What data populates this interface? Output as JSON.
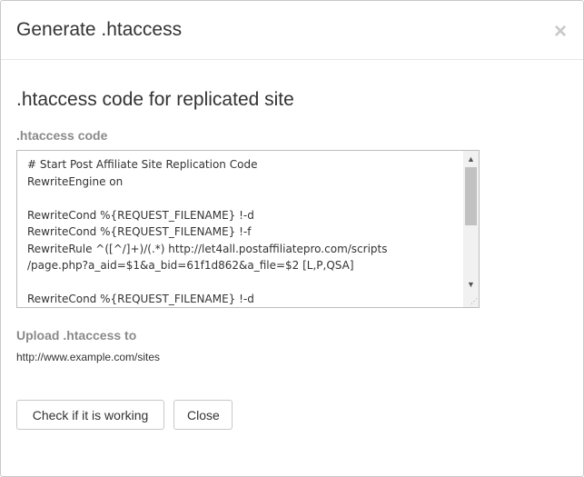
{
  "dialog": {
    "title": "Generate .htaccess",
    "close_glyph": "×"
  },
  "section": {
    "heading": ".htaccess code for replicated site"
  },
  "code_field": {
    "label": ".htaccess code",
    "lines": [
      "# Start Post Affiliate Site Replication Code",
      "RewriteEngine on",
      "",
      "RewriteCond %{REQUEST_FILENAME} !-d",
      "RewriteCond %{REQUEST_FILENAME} !-f",
      "RewriteRule ^([^/]+)/(.*) http://let4all.postaffiliatepro.com/scripts",
      "/page.php?a_aid=$1&a_bid=61f1d862&a_file=$2 [L,P,QSA]",
      "",
      "RewriteCond %{REQUEST_FILENAME} !-d"
    ]
  },
  "upload": {
    "label": "Upload .htaccess to",
    "url": "http://www.example.com/sites"
  },
  "buttons": {
    "check_label": "Check if it is working",
    "close_label": "Close"
  },
  "colors": {
    "label_gray": "#8a8a8a",
    "border": "#c8c8c8"
  }
}
